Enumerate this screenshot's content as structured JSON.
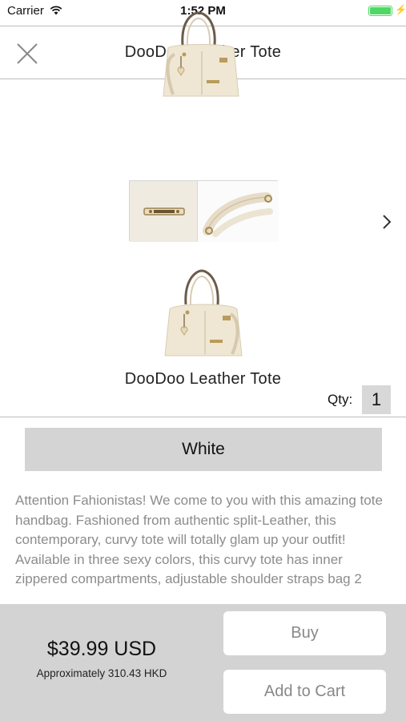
{
  "status_bar": {
    "carrier": "Carrier",
    "time": "1:52 PM",
    "wifi_icon": "wifi-icon",
    "battery_icon": "battery-icon"
  },
  "nav": {
    "title": "DooDoo Leather Tote",
    "close_icon": "close-icon"
  },
  "gallery": {
    "images": [
      "handbag-image",
      "hardware-detail-image",
      "strap-detail-image",
      "handbag-image"
    ],
    "next_icon": "chevron-right-icon"
  },
  "product": {
    "name": "DooDoo Leather Tote",
    "qty_label": "Qty:",
    "qty_value": "1",
    "color_option": "White",
    "description": "Attention Fahionistas! We come to you with this amazing tote handbag. Fashioned from authentic split-Leather, this contemporary, curvy tote will totally glam up your outfit! Available in three sexy colors, this curvy tote has inner zippered compartments, adjustable shoulder straps bag 2"
  },
  "footer": {
    "price": "$39.99 USD",
    "price_approx": "Approximately 310.43 HKD",
    "buy_label": "Buy",
    "add_to_cart_label": "Add to Cart"
  },
  "colors": {
    "accent_battery": "#4cd964",
    "footer_bg": "#d3d3d3",
    "button_text": "#888888",
    "description_text": "#8c8c8c"
  }
}
